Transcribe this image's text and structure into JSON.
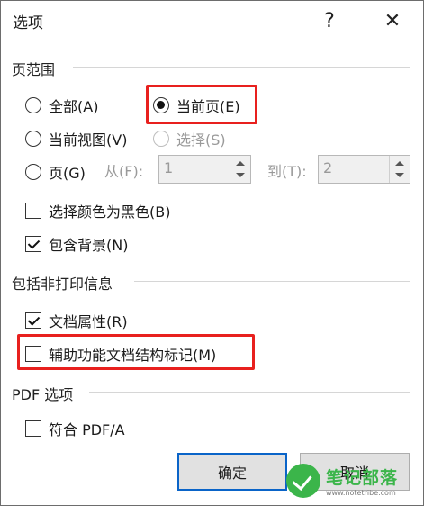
{
  "title": "选项",
  "title_buttons": {
    "help": "?",
    "close": "✕"
  },
  "page_range": {
    "label": "页范围",
    "all": "全部(A)",
    "current_page": "当前页(E)",
    "current_view": "当前视图(V)",
    "selection": "选择(S)",
    "pages": "页(G)",
    "from_label": "从(F):",
    "from_value": "1",
    "to_label": "到(T):",
    "to_value": "2",
    "selected": "current_page"
  },
  "options": {
    "black_white": {
      "label": "选择颜色为黑色(B)",
      "checked": false
    },
    "background": {
      "label": "包含背景(N)",
      "checked": true
    }
  },
  "non_print": {
    "label": "包括非打印信息",
    "doc_props": {
      "label": "文档属性(R)",
      "checked": true
    },
    "accessibility": {
      "label": "辅助功能文档结构标记(M)",
      "checked": false
    }
  },
  "pdf_options": {
    "label": "PDF 选项",
    "pdfa": {
      "label": "符合 PDF/A",
      "checked": false
    }
  },
  "buttons": {
    "ok": "确定",
    "cancel": "取消"
  },
  "watermark": {
    "main": "笔记部落",
    "sub": "www.notetribe.com"
  },
  "colors": {
    "highlight": "#e8201e",
    "primary_border": "#0a64c8",
    "watermark": "#3bb54a"
  }
}
